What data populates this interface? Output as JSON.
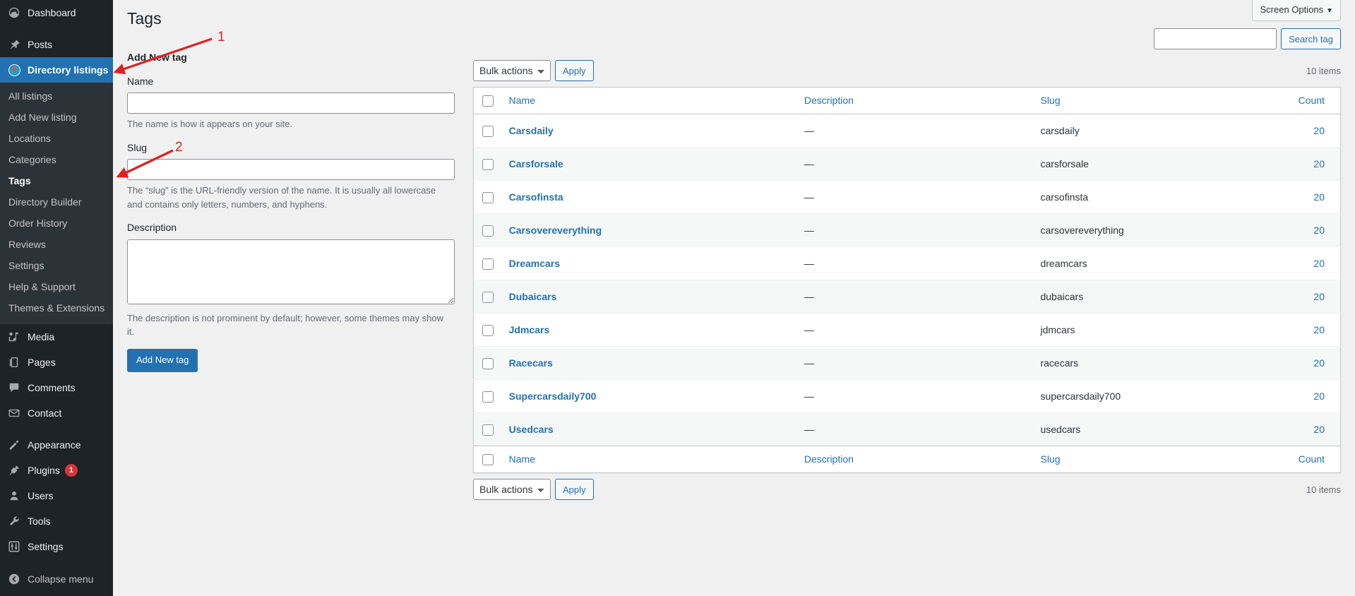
{
  "sidebar": {
    "items": [
      {
        "label": "Dashboard",
        "icon": "dashboard-icon",
        "current": false
      },
      {
        "label": "Posts",
        "icon": "pin-icon",
        "current": false
      },
      {
        "label": "Directory listings",
        "icon": "map-marker-icon",
        "current": true
      }
    ],
    "submenu": [
      {
        "label": "All listings",
        "current": false
      },
      {
        "label": "Add New listing",
        "current": false
      },
      {
        "label": "Locations",
        "current": false
      },
      {
        "label": "Categories",
        "current": false
      },
      {
        "label": "Tags",
        "current": true
      },
      {
        "label": "Directory Builder",
        "current": false
      },
      {
        "label": "Order History",
        "current": false
      },
      {
        "label": "Reviews",
        "current": false
      },
      {
        "label": "Settings",
        "current": false
      },
      {
        "label": "Help & Support",
        "current": false
      },
      {
        "label": "Themes & Extensions",
        "current": false
      }
    ],
    "group2": [
      {
        "label": "Media",
        "icon": "media-icon"
      },
      {
        "label": "Pages",
        "icon": "pages-icon"
      },
      {
        "label": "Comments",
        "icon": "comments-icon"
      },
      {
        "label": "Contact",
        "icon": "envelope-icon"
      }
    ],
    "group3": [
      {
        "label": "Appearance",
        "icon": "paintbrush-icon",
        "badge": ""
      },
      {
        "label": "Plugins",
        "icon": "plug-icon",
        "badge": "1"
      },
      {
        "label": "Users",
        "icon": "users-icon",
        "badge": ""
      },
      {
        "label": "Tools",
        "icon": "wrench-icon",
        "badge": ""
      },
      {
        "label": "Settings",
        "icon": "sliders-icon",
        "badge": ""
      }
    ],
    "collapse": {
      "label": "Collapse menu",
      "icon": "collapse-arrow-icon"
    }
  },
  "header": {
    "screen_options": "Screen Options",
    "screen_options_caret": "▼",
    "page_title": "Tags"
  },
  "form": {
    "heading": "Add New tag",
    "name_label": "Name",
    "name_value": "",
    "name_placeholder": "",
    "name_help": "The name is how it appears on your site.",
    "slug_label": "Slug",
    "slug_value": "",
    "slug_placeholder": "",
    "slug_help": "The “slug” is the URL-friendly version of the name. It is usually all lowercase and contains only letters, numbers, and hyphens.",
    "description_label": "Description",
    "description_value": "",
    "description_placeholder": "",
    "description_help": "The description is not prominent by default; however, some themes may show it.",
    "submit_label": "Add New tag"
  },
  "search": {
    "value": "",
    "placeholder": "",
    "button_label": "Search tag"
  },
  "tablenav": {
    "bulk_actions_label": "Bulk actions",
    "bulk_actions_caret": "⌄",
    "apply_label": "Apply",
    "displaying_num": "10 items"
  },
  "table": {
    "columns": {
      "name": "Name",
      "description": "Description",
      "slug": "Slug",
      "count": "Count"
    },
    "rows": [
      {
        "name": "Carsdaily",
        "description": "—",
        "slug": "carsdaily",
        "count": "20"
      },
      {
        "name": "Carsforsale",
        "description": "—",
        "slug": "carsforsale",
        "count": "20"
      },
      {
        "name": "Carsofinsta",
        "description": "—",
        "slug": "carsofinsta",
        "count": "20"
      },
      {
        "name": "Carsovereverything",
        "description": "—",
        "slug": "carsovereverything",
        "count": "20"
      },
      {
        "name": "Dreamcars",
        "description": "—",
        "slug": "dreamcars",
        "count": "20"
      },
      {
        "name": "Dubaicars",
        "description": "—",
        "slug": "dubaicars",
        "count": "20"
      },
      {
        "name": "Jdmcars",
        "description": "—",
        "slug": "jdmcars",
        "count": "20"
      },
      {
        "name": "Racecars",
        "description": "—",
        "slug": "racecars",
        "count": "20"
      },
      {
        "name": "Supercarsdaily700",
        "description": "—",
        "slug": "supercarsdaily700",
        "count": "20"
      },
      {
        "name": "Usedcars",
        "description": "—",
        "slug": "usedcars",
        "count": "20"
      }
    ]
  },
  "annotations": [
    {
      "number": "1",
      "target": "add-new-tag-heading"
    },
    {
      "number": "2",
      "target": "slug-label"
    }
  ],
  "colors": {
    "accent": "#2271b1",
    "sidebar_bg": "#1d2327",
    "submenu_bg": "#2c3338",
    "badge": "#d63638",
    "annotation": "#e02020"
  }
}
